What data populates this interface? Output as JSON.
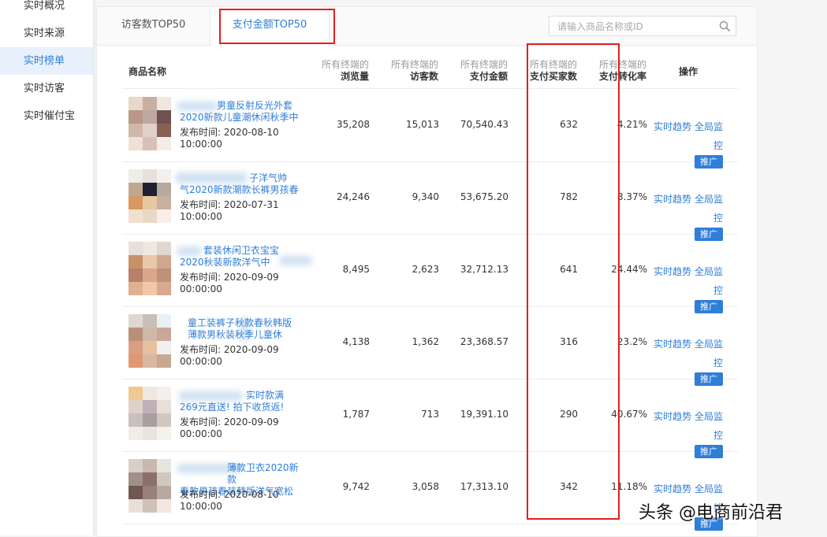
{
  "sidebar": {
    "items": [
      {
        "label": "实时概况",
        "active": false
      },
      {
        "label": "实时来源",
        "active": false
      },
      {
        "label": "实时榜单",
        "active": true
      },
      {
        "label": "实时访客",
        "active": false
      },
      {
        "label": "实时催付宝",
        "active": false
      }
    ]
  },
  "tabs": [
    {
      "label": "访客数TOP50",
      "active": false
    },
    {
      "label": "支付金额TOP50",
      "active": true
    }
  ],
  "search": {
    "placeholder": "请输入商品名称或ID",
    "icon": "search-icon"
  },
  "table": {
    "headers": {
      "name": "商品名称",
      "prefix": "所有终端的",
      "views": "浏览量",
      "visitors": "访客数",
      "amount": "支付金额",
      "buyers": "支付买家数",
      "conversion": "支付转化率",
      "ops": "操作"
    },
    "date_label": "发布时间:",
    "op_trend": "实时趋势",
    "op_monitor_a": "全局监",
    "op_monitor_b": "控",
    "op_promo": "推广",
    "rows": [
      {
        "title_l1": "男童反射反光外套",
        "title_l2": "2020新款儿童潮休闲秋季中",
        "date": "2020-08-10",
        "time": "10:00:00",
        "views": "35,208",
        "visitors": "15,013",
        "amount": "70,540.43",
        "buyers": "632",
        "conversion": "4.21%"
      },
      {
        "title_l1": "子洋气帅",
        "title_l2": "气2020新款潮款长裤男孩春",
        "date": "2020-07-31",
        "time": "10:00:00",
        "views": "24,246",
        "visitors": "9,340",
        "amount": "53,675.20",
        "buyers": "782",
        "conversion": "8.37%"
      },
      {
        "title_l1": "套装休闲卫衣宝宝",
        "title_l2": "2020秋装新款洋气中",
        "date": "2020-09-09",
        "time": "00:00:00",
        "views": "8,495",
        "visitors": "2,623",
        "amount": "32,712.13",
        "buyers": "641",
        "conversion": "24.44%"
      },
      {
        "title_l1": "童工装裤子秋款春秋韩版",
        "title_l2": "薄款男秋装秋季儿童休",
        "date": "2020-09-09",
        "time": "00:00:00",
        "views": "4,138",
        "visitors": "1,362",
        "amount": "23,368.57",
        "buyers": "316",
        "conversion": "23.2%"
      },
      {
        "title_l1": "实时款满",
        "title_l2": "269元直送! 拍下收货返!",
        "date": "2020-09-09",
        "time": "00:00:00",
        "views": "1,787",
        "visitors": "713",
        "amount": "19,391.10",
        "buyers": "290",
        "conversion": "40.67%"
      },
      {
        "title_l1": "薄款卫衣2020新款",
        "title_l2": "春款男孩春装韩版洋气宽松",
        "date": "2020-08-10",
        "time": "10:00:00",
        "views": "9,742",
        "visitors": "3,058",
        "amount": "17,313.10",
        "buyers": "342",
        "conversion": "11.18%"
      }
    ]
  },
  "colors": {
    "accent": "#2f7ed8",
    "highlight": "#e02020"
  },
  "watermark": "头条 @电商前沿君"
}
